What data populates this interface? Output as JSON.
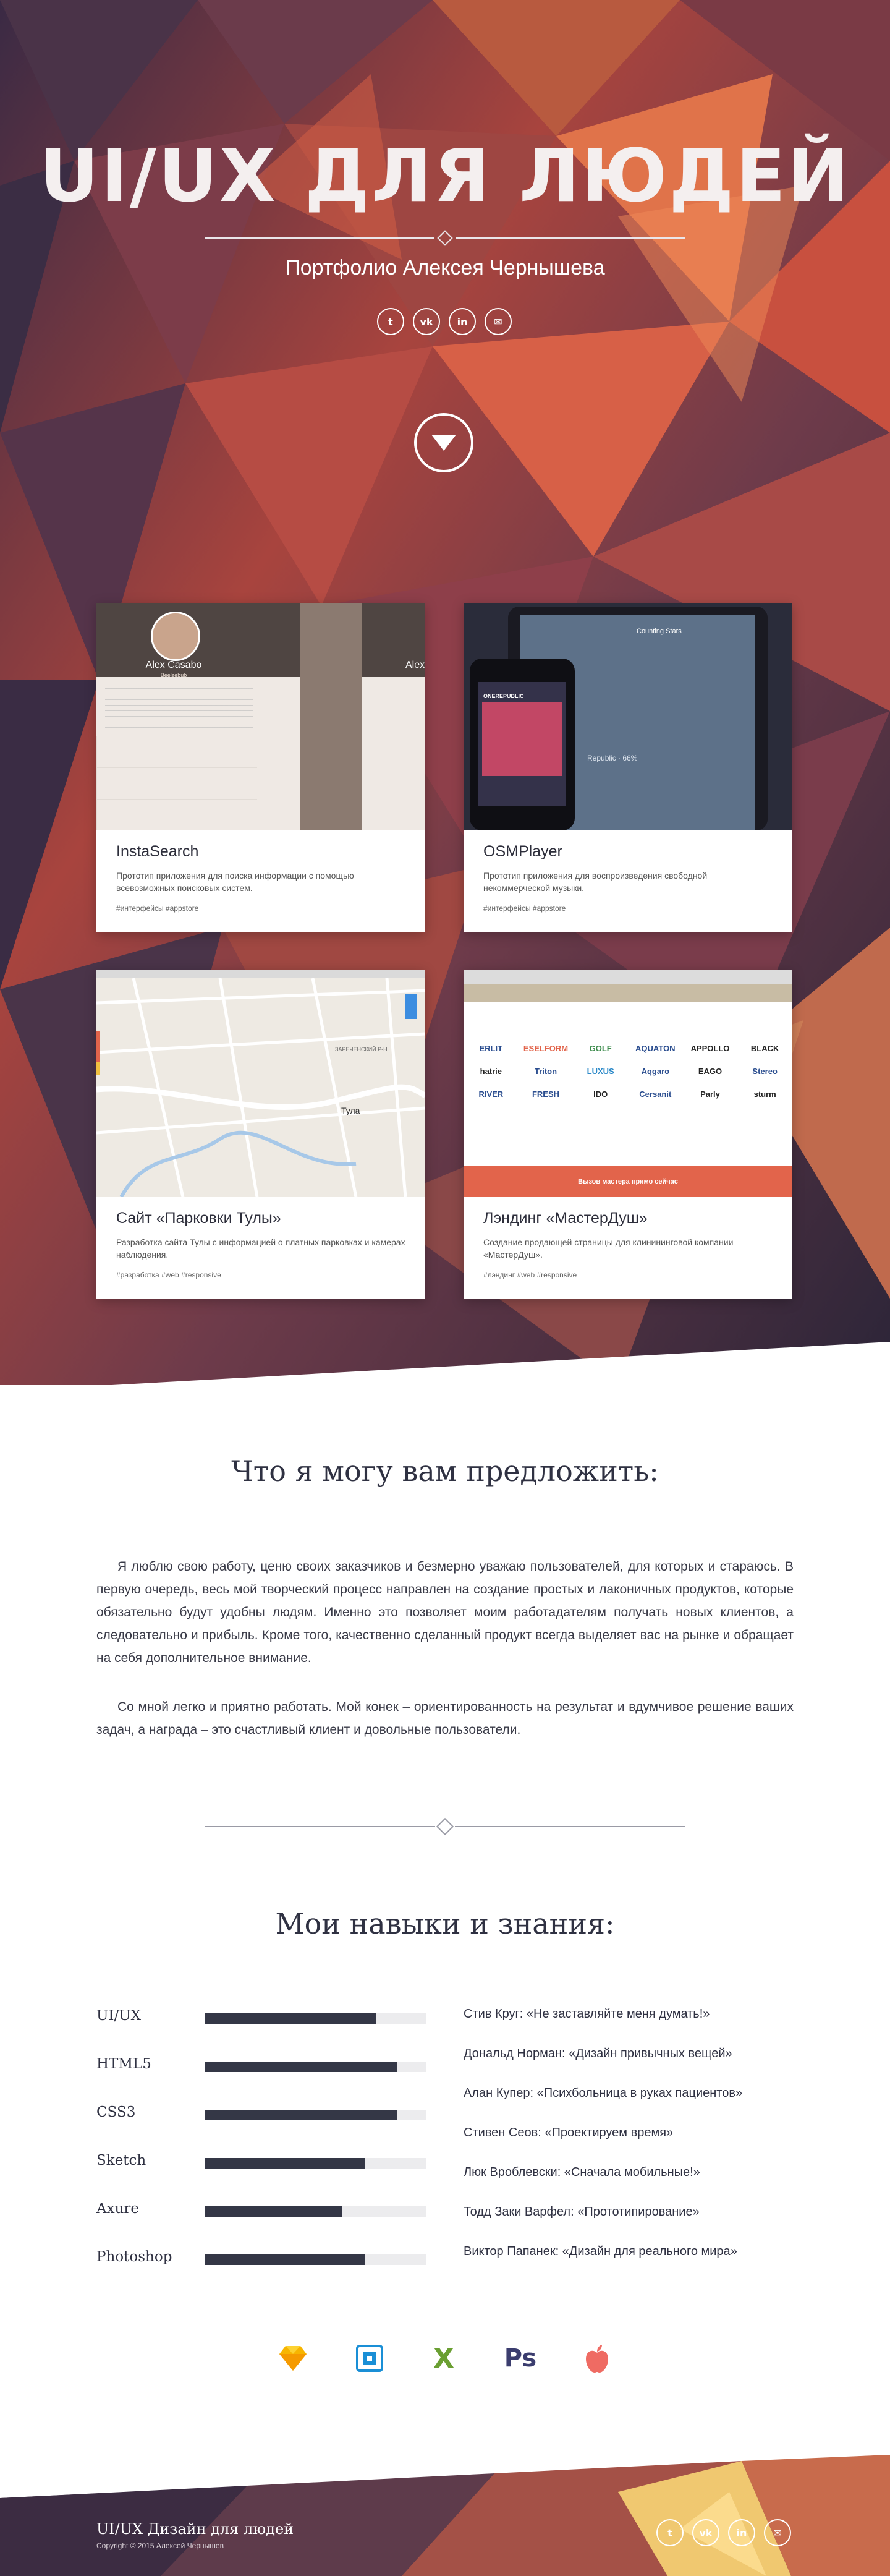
{
  "hero": {
    "title": "UI/UX ДЛЯ ЛЮДЕЙ",
    "subtitle": "Портфолио Алексея Чернышева",
    "social": [
      {
        "icon": "twitter-icon",
        "glyph": "t"
      },
      {
        "icon": "vk-icon",
        "glyph": "vk"
      },
      {
        "icon": "linkedin-icon",
        "glyph": "in"
      },
      {
        "icon": "mail-icon",
        "glyph": "✉"
      }
    ],
    "scroll_icon": "chevron-down-icon"
  },
  "portfolio": [
    {
      "title": "InstaSearch",
      "description": "Прототип приложения для поиска информации с  помощью всевозможных поисковых систем.",
      "tags": "#интерфейсы #appstore",
      "thumb": {
        "profile_name": "Alex Casabo",
        "profile_sub": "Beelzebub",
        "profile_name_2": "Alex"
      }
    },
    {
      "title": "OSMPlayer",
      "description": "Прототип приложения для воспроизведения свободной некоммерческой музыки.",
      "tags": "#интерфейсы #appstore",
      "thumb": {
        "track": "Counting Stars",
        "artist": "OneRepublic",
        "album_label": "ONEREPUBLIC",
        "status": "Republic · 66%"
      }
    },
    {
      "title": "Сайт «Парковки Тулы»",
      "description": "Разработка сайта Тулы с информацией о платных парковках и камерах наблюдения.",
      "tags": "#разработка #web #responsive",
      "thumb": {
        "city": "Тула",
        "district": "ЗАРЕЧЕНСКИЙ Р-Н"
      }
    },
    {
      "title": "Лэндинг «МастерДуш»",
      "description": "Создание продающей страницы для клинининговой компании «МастерДуш».",
      "tags": "#лэндинг #web #responsive",
      "thumb": {
        "cta": "Вызов мастера прямо сейчас",
        "brands": [
          "ERLIT",
          "ESELFORM",
          "GOLF",
          "AQUATON",
          "APPOLLO",
          "BLACK",
          "hatrie",
          "Triton",
          "LUXUS",
          "Aqgaro",
          "EAGO",
          "Stereo",
          "RIVER",
          "FRESH",
          "IDO",
          "Cersanit",
          "Parly",
          "sturm"
        ]
      }
    }
  ],
  "offer": {
    "title": "Что я могу вам предложить:",
    "paragraphs": [
      "Я люблю свою работу, ценю своих заказчиков и безмерно уважаю пользователей, для которых и стараюсь. В первую очередь, весь мой творческий процесс направлен на создание простых и лаконичных продуктов, которые обязательно будут удобны людям. Именно это позволяет моим работадателям получать новых клиентов, а следовательно и прибыль. Кроме того, качественно сделанный продукт всегда выделяет вас на рынке и обращает на себя дополнительное внимание.",
      "Со мной легко и приятно работать. Мой конек – ориентированность на результат и вдумчивое решение ваших задач, а награда – это счастливый клиент и довольные пользователи."
    ]
  },
  "skills": {
    "title": "Мои навыки и знания:",
    "items": [
      {
        "name": "UI/UX",
        "level": 0.77
      },
      {
        "name": "HTML5",
        "level": 0.87
      },
      {
        "name": "CSS3",
        "level": 0.87
      },
      {
        "name": "Sketch",
        "level": 0.72
      },
      {
        "name": "Axure",
        "level": 0.62
      },
      {
        "name": "Photoshop",
        "level": 0.72
      }
    ],
    "books": [
      "Стив Круг: «Не заставляйте меня думать!»",
      "Дональд Норман: «Дизайн привычных вещей»",
      "Алан Купер: «Психбольница в руках пациентов»",
      "Стивен Сеов: «Проектируем время»",
      "Люк Вроблевски: «Сначала мобильные!»",
      "Тодд Заки Варфел:  «Прототипирование»",
      "Виктор Папанек: «Дизайн для реального мира»"
    ]
  },
  "tools": [
    {
      "icon": "sketch-icon",
      "color": "#f7b500"
    },
    {
      "icon": "axure-icon",
      "color": "#1a8fd6"
    },
    {
      "icon": "x-icon",
      "color": "#6a9f32",
      "glyph": "X"
    },
    {
      "icon": "photoshop-icon",
      "color": "#3b3d6e",
      "glyph": "Ps"
    },
    {
      "icon": "apple-icon",
      "color": "#ef6b63"
    }
  ],
  "footer": {
    "title": "UI/UX Дизайн для людей",
    "copyright": "Copyright © 2015 Алексей Чернышев"
  },
  "colors": {
    "dark": "#2f3142",
    "bar": "#343746",
    "track": "#ececee",
    "accent": "#e2644b"
  }
}
